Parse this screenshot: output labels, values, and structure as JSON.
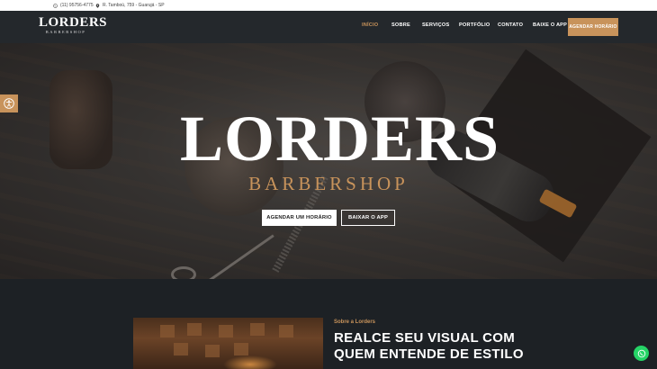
{
  "topbar": {
    "phone": "(11) 95756-4775",
    "address": "R. Tamboú, 759 - Guarujá - SP"
  },
  "header": {
    "logo_main": "LORDERS",
    "logo_sub": "BARBERSHOP",
    "nav": [
      {
        "label": "INÍCIO",
        "active": true
      },
      {
        "label": "SOBRE",
        "active": false
      },
      {
        "label": "SERVIÇOS",
        "active": false
      },
      {
        "label": "PORTFÓLIO",
        "active": false
      },
      {
        "label": "CONTATO",
        "active": false
      },
      {
        "label": "BAIXE O APP",
        "active": false
      }
    ],
    "cta": "AGENDAR HORÁRIO"
  },
  "hero": {
    "logo_main": "LORDERS",
    "logo_sub": "BARBERSHOP",
    "primary_button": "AGENDAR UM HORÁRIO",
    "secondary_button": "BAIXAR O APP"
  },
  "about": {
    "eyebrow": "Sobre a Lorders",
    "headline": "REALCE SEU VISUAL COM QUEM ENTENDE DE ESTILO"
  },
  "icons": {
    "whatsapp": "whatsapp-icon",
    "location": "location-pin-icon",
    "accessibility": "accessibility-icon"
  },
  "colors": {
    "accent": "#c8935b",
    "header_bg": "#24282c",
    "page_bg": "#1d2125",
    "whatsapp": "#25d366"
  }
}
